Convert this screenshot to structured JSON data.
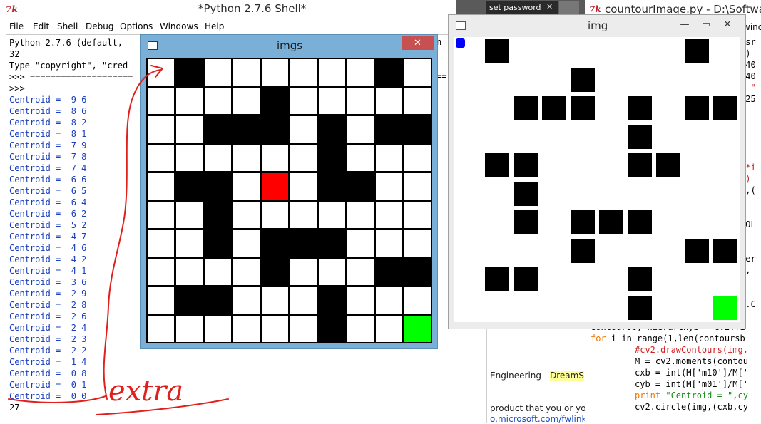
{
  "shell": {
    "title": "*Python 2.7.6 Shell*",
    "menu": [
      "File",
      "Edit",
      "Shell",
      "Debug",
      "Options",
      "Windows",
      "Help"
    ],
    "header_lines": [
      "Python 2.7.6 (default,",
      "32",
      "Type \"copyright\", \"cred",
      ">>> ====================",
      ">>>"
    ],
    "right_frag": [
      "n",
      "=="
    ],
    "centroids": [
      "Centroid =  9 6",
      "Centroid =  8 6",
      "Centroid =  8 2",
      "Centroid =  8 1",
      "Centroid =  7 9",
      "Centroid =  7 8",
      "Centroid =  7 4",
      "Centroid =  6 6",
      "Centroid =  6 5",
      "Centroid =  6 4",
      "Centroid =  6 2",
      "Centroid =  5 2",
      "Centroid =  4 7",
      "Centroid =  4 6",
      "Centroid =  4 2",
      "Centroid =  4 1",
      "Centroid =  3 6",
      "Centroid =  2 9",
      "Centroid =  2 8",
      "Centroid =  2 6",
      "Centroid =  2 4",
      "Centroid =  2 3",
      "Centroid =  2 2",
      "Centroid =  1 4",
      "Centroid =  0 8",
      "Centroid =  0 1",
      "Centroid =  0 0"
    ],
    "last_line": "27"
  },
  "imgs_window": {
    "title": "imgs",
    "close_label": "✕",
    "rows": [
      "WBWWWWWWBW",
      "WWWWBWWWWW",
      "WWBBBWBWBB",
      "WWWWWWBWWW",
      "WBBWRWBBWW",
      "WWBWWWWWWW",
      "WWBWBBBWWW",
      "WWWWBWWWBB",
      "WBBWWWBWWW",
      "WWWWWWBWWG"
    ],
    "colors": {
      "B": "#000000",
      "W": "#ffffff",
      "R": "#ff0000",
      "G": "#00ff00",
      "grid": "#000000"
    }
  },
  "img_window": {
    "title": "img",
    "rows": [
      "WBWWWWWWBW",
      "WWWWBWWWWW",
      "WWBBBWBWBB",
      "WWWWWWBWWW",
      "WBBWWWBBWW",
      "WWBWWWWWWW",
      "WWBWBBBWWW",
      "WWWWBWWWBB",
      "WBBWWWBWWW",
      "WWWWWWBWWG"
    ],
    "colors": {
      "B": "#000000",
      "W": "#ffffff",
      "G": "#00ff00",
      "marker": "#0000ff"
    }
  },
  "contour": {
    "title": "countourImage.py - D:\\Software\\",
    "frag_lines": [
      "rsr",
      "])",
      "/40",
      "/40",
      ", \"",
      "(25",
      "",
      "",
      "",
      "",
      "",
      "0*i",
      "i)",
      "g,(",
      "",
      "",
      "COL",
      "",
      "",
      "wer",
      "g,",
      "",
      "",
      "2.C"
    ],
    "code_lines": [
      {
        "indent": 0,
        "text": "",
        "kw": "",
        "rest": "contoursb, hierarchyb = cv2.fi"
      },
      {
        "indent": 0,
        "text": "",
        "kw": "for",
        "rest": " i in range(1,len(contoursb"
      },
      {
        "indent": 1,
        "text": "#cv2.drawContours(img,",
        "kw": "",
        "rest": ""
      },
      {
        "indent": 1,
        "text": "",
        "kw": "",
        "rest": "M = cv2.moments(contou"
      },
      {
        "indent": 1,
        "text": "",
        "kw": "",
        "rest": "cxb = int(M['m10']/M['"
      },
      {
        "indent": 1,
        "text": "",
        "kw": "",
        "rest": "cyb = int(M['m01']/M['"
      },
      {
        "indent": 1,
        "text": "",
        "kw": "print",
        "rest": " \"Centroid = \",cy"
      },
      {
        "indent": 1,
        "text": "",
        "kw": "",
        "rest": "cv2.circle(img,(cxb,cy"
      }
    ],
    "windo": "windo"
  },
  "browser": {
    "tab_label": "set password",
    "frag1": "Engineering - ",
    "frag1_hl": "DreamS",
    "frag2": "product that you or you",
    "frag3": "o.microsoft.com/fwlink"
  },
  "annotation": {
    "text": "extra",
    "color": "#e0201c"
  }
}
